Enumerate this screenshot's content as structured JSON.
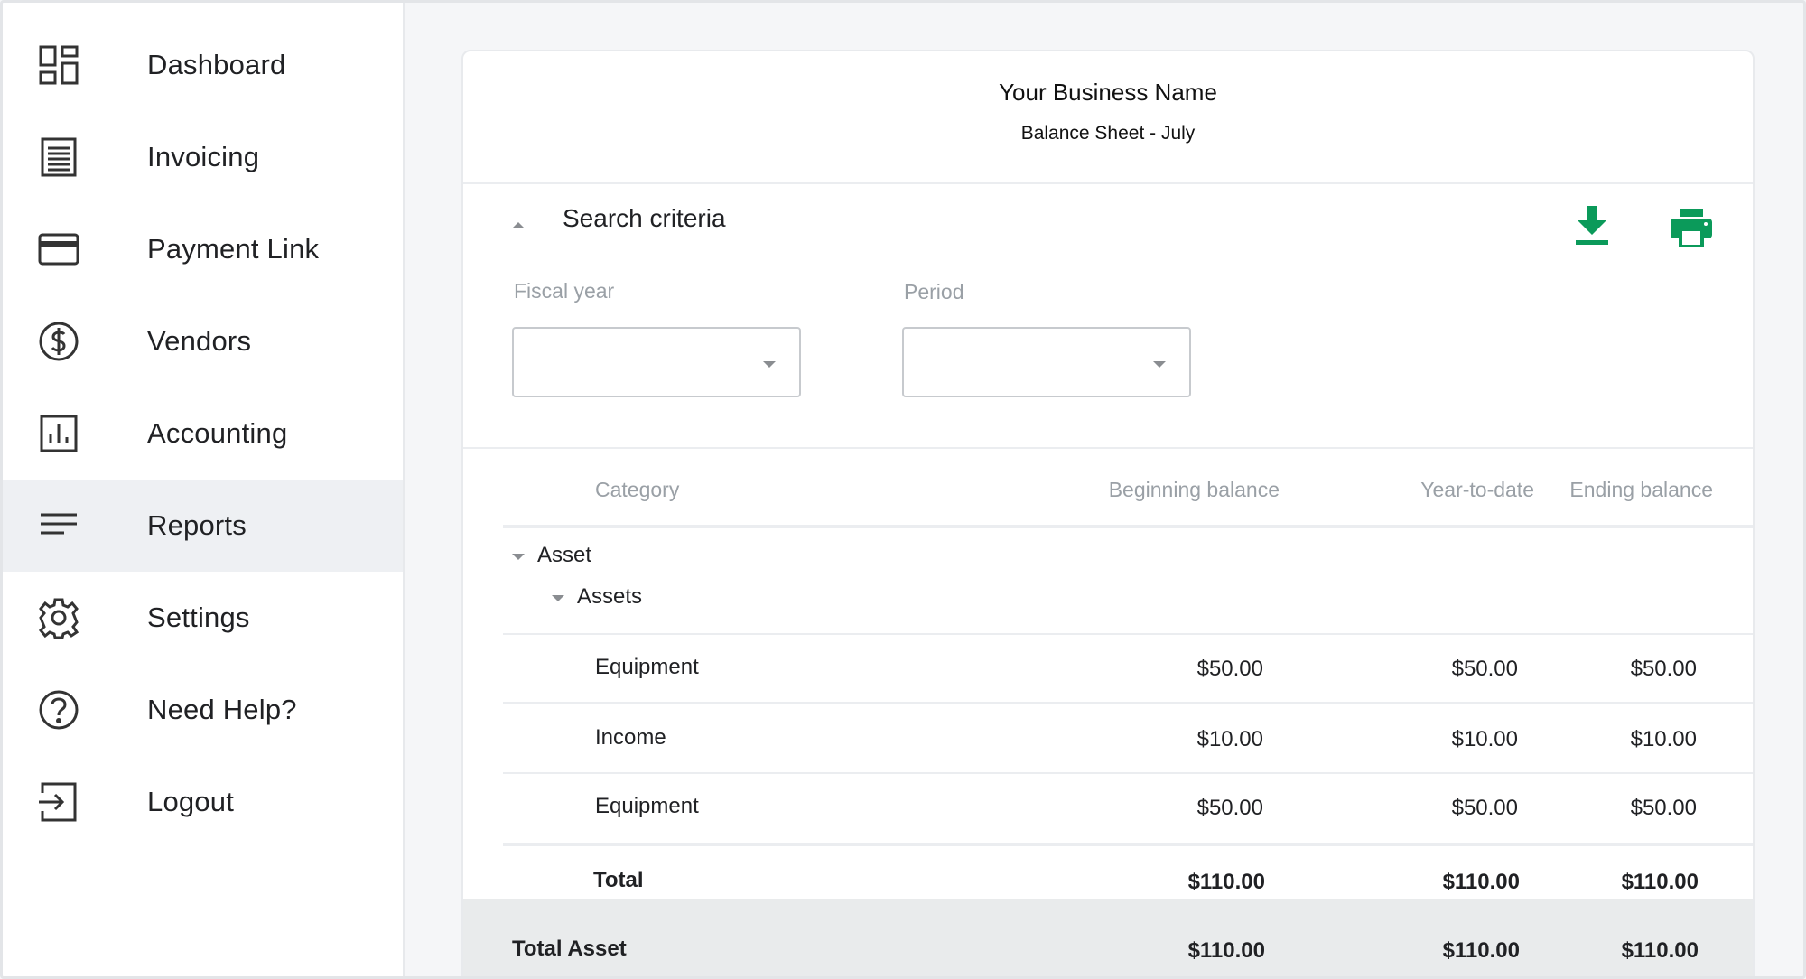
{
  "sidebar": {
    "items": [
      {
        "label": "Dashboard",
        "icon": "dashboard-icon"
      },
      {
        "label": "Invoicing",
        "icon": "receipt-icon"
      },
      {
        "label": "Payment Link",
        "icon": "credit-card-icon"
      },
      {
        "label": "Vendors",
        "icon": "dollar-circle-icon"
      },
      {
        "label": "Accounting",
        "icon": "bar-chart-icon"
      },
      {
        "label": "Reports",
        "icon": "lines-icon",
        "active": true
      },
      {
        "label": "Settings",
        "icon": "gear-icon"
      },
      {
        "label": "Need Help?",
        "icon": "help-circle-icon"
      },
      {
        "label": "Logout",
        "icon": "logout-icon"
      }
    ]
  },
  "report": {
    "business_name": "Your Business Name",
    "title": "Balance Sheet - July"
  },
  "search": {
    "title": "Search criteria",
    "fiscal_year_label": "Fiscal year",
    "fiscal_year_value": "",
    "period_label": "Period",
    "period_value": ""
  },
  "colors": {
    "accent": "#0b9a5a",
    "active_nav_bg": "#eef0f3",
    "total_bar_bg": "#e9ebec"
  },
  "table": {
    "headers": {
      "category": "Category",
      "beginning": "Beginning balance",
      "ytd": "Year-to-date",
      "ending": "Ending balance"
    },
    "group": "Asset",
    "subgroup": "Assets",
    "rows": [
      {
        "category": "Equipment",
        "beginning": "$50.00",
        "ytd": "$50.00",
        "ending": "$50.00"
      },
      {
        "category": "Income",
        "beginning": "$10.00",
        "ytd": "$10.00",
        "ending": "$10.00"
      },
      {
        "category": "Equipment",
        "beginning": "$50.00",
        "ytd": "$50.00",
        "ending": "$50.00"
      }
    ],
    "total": {
      "label": "Total",
      "beginning": "$110.00",
      "ytd": "$110.00",
      "ending": "$110.00"
    },
    "total_asset": {
      "label": "Total Asset",
      "beginning": "$110.00",
      "ytd": "$110.00",
      "ending": "$110.00"
    }
  }
}
